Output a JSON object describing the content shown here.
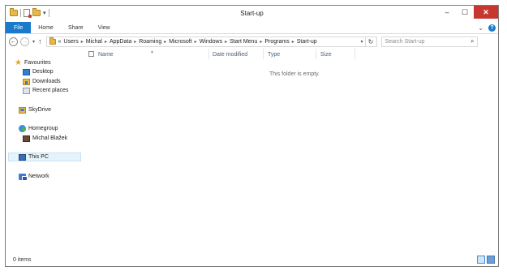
{
  "window": {
    "title": "Start-up"
  },
  "ribbon": {
    "tabs": [
      "File",
      "Home",
      "Share",
      "View"
    ]
  },
  "address": {
    "crumbs": [
      "Users",
      "Michal",
      "AppData",
      "Roaming",
      "Microsoft",
      "Windows",
      "Start Menu",
      "Programs",
      "Start-up"
    ],
    "overflow": "«"
  },
  "search": {
    "placeholder": "Search Start-up"
  },
  "nav": {
    "favourites": "Favourites",
    "desktop": "Desktop",
    "downloads": "Downloads",
    "recent": "Recent places",
    "skydrive": "SkyDrive",
    "homegroup": "Homegroup",
    "user": "Michal Blažek",
    "thispc": "This PC",
    "network": "Network"
  },
  "columns": {
    "name": "Name",
    "date": "Date modified",
    "type": "Type",
    "size": "Size"
  },
  "content": {
    "empty_message": "This folder is empty."
  },
  "status": {
    "items": "0 items"
  },
  "colors": {
    "accent": "#1979ca",
    "close": "#c7372f",
    "selection": "#e5f3fb"
  }
}
